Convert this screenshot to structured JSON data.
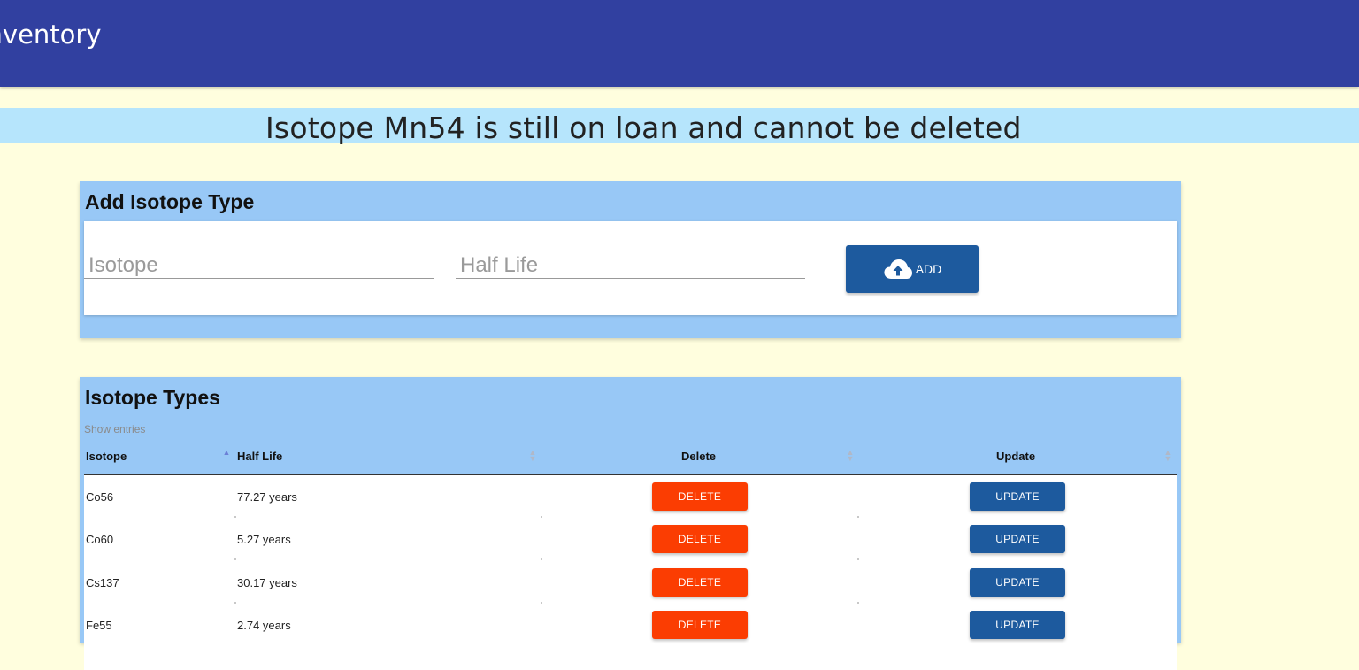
{
  "header": {
    "title": "Inventory"
  },
  "alert": {
    "message": "Isotope Mn54 is still on loan and cannot be deleted"
  },
  "add_form": {
    "title": "Add Isotope Type",
    "isotope_placeholder": "Isotope",
    "halflife_placeholder": "Half Life",
    "add_label": "ADD",
    "add_icon": "cloud-upload-icon"
  },
  "table": {
    "title": "Isotope Types",
    "show_entries": "Show entries",
    "columns": [
      "Isotope",
      "Half Life",
      "Delete",
      "Update"
    ],
    "sorted_column": "Isotope",
    "sort_direction": "ascending",
    "rows": [
      {
        "isotope": "Co56",
        "half_life": "77.27 years",
        "delete": "DELETE",
        "update": "UPDATE"
      },
      {
        "isotope": "Co60",
        "half_life": "5.27 years",
        "delete": "DELETE",
        "update": "UPDATE"
      },
      {
        "isotope": "Cs137",
        "half_life": "30.17 years",
        "delete": "DELETE",
        "update": "UPDATE"
      },
      {
        "isotope": "Fe55",
        "half_life": "2.74 years",
        "delete": "DELETE",
        "update": "UPDATE"
      }
    ]
  },
  "colors": {
    "header_bg": "#3140a0",
    "page_bg": "#fffede",
    "alert_bg": "#b6e5fc",
    "card_bg": "#98c8f6",
    "primary_button": "#1d5a9e",
    "delete_button": "#fb3d02"
  }
}
